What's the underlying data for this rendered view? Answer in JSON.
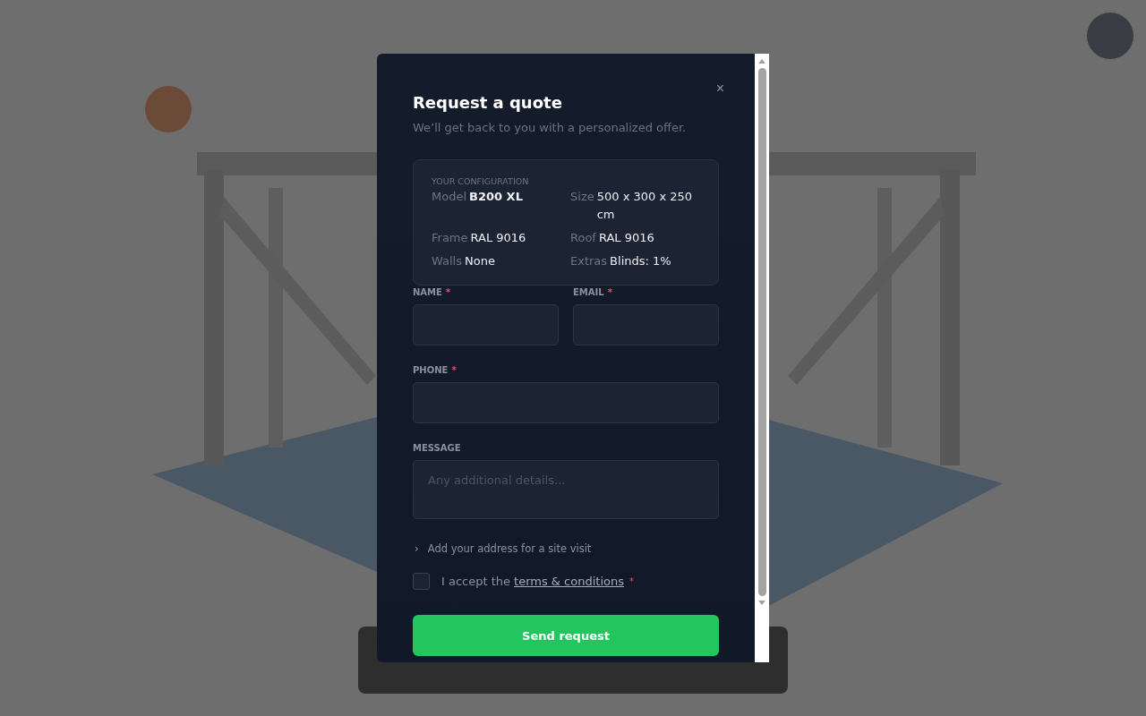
{
  "dialog": {
    "title": "Request a quote",
    "subtitle": "We’ll get back to you with a personalized offer.",
    "close": "×"
  },
  "configuration": {
    "heading": "YOUR CONFIGURATION",
    "items": [
      {
        "label": "Model",
        "value": "B200 XL",
        "bold": true
      },
      {
        "label": "Size",
        "value": "500 x 300 x 250 cm",
        "bold": false
      },
      {
        "label": "Frame",
        "value": "RAL 9016",
        "bold": false
      },
      {
        "label": "Roof",
        "value": "RAL 9016",
        "bold": false
      },
      {
        "label": "Walls",
        "value": "None",
        "bold": false
      },
      {
        "label": "Extras",
        "value": "Blinds: 1%",
        "bold": false
      }
    ]
  },
  "fields": [
    {
      "label": "NAME",
      "required_mark": "*",
      "kind": "half"
    },
    {
      "label": "EMAIL",
      "required_mark": "*",
      "kind": "half"
    },
    {
      "label": "PHONE",
      "required_mark": "*",
      "kind": "input"
    },
    {
      "label": "MESSAGE",
      "kind": "textarea",
      "placeholder": "Any additional details..."
    }
  ],
  "address_toggle": {
    "icon": "›",
    "label": "Add your address for a site visit",
    "expanded": false
  },
  "terms": {
    "checked": false,
    "text": "I accept the",
    "link": "terms & conditions",
    "required_mark": "*"
  },
  "submit": {
    "label": "Send request"
  }
}
